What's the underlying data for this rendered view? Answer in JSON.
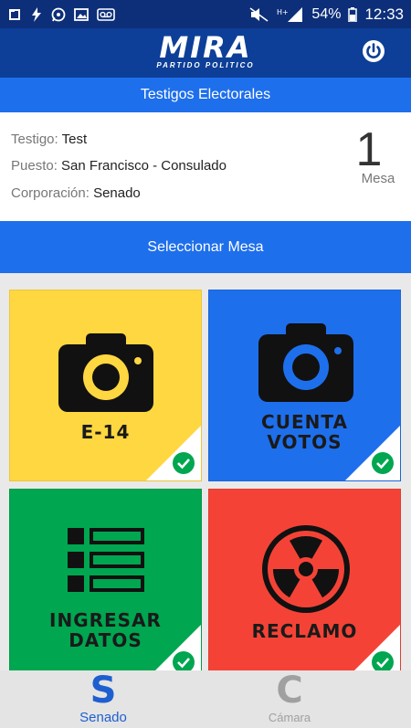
{
  "status_bar": {
    "icons_left": [
      "notification-icon",
      "flash-icon",
      "whatsapp-icon",
      "image-icon",
      "voicemail-icon"
    ],
    "battery": "54%",
    "time": "12:33"
  },
  "header": {
    "logo_title": "MIRA",
    "logo_subtitle": "PARTIDO POLITICO",
    "power_icon": "power-icon"
  },
  "section_title": "Testigos Electorales",
  "info": {
    "testigo_label": "Testigo:",
    "testigo_value": "Test",
    "puesto_label": "Puesto:",
    "puesto_value": "San Francisco - Consulado",
    "corporacion_label": "Corporación:",
    "corporacion_value": "Senado",
    "mesa_number": "1",
    "mesa_label": "Mesa"
  },
  "select_button": "Seleccionar Mesa",
  "tiles": [
    {
      "label_line1": "E-14",
      "label_line2": "",
      "color": "#ffd740",
      "icon": "camera-icon"
    },
    {
      "label_line1": "CUENTA",
      "label_line2": "VOTOS",
      "color": "#1e6fec",
      "icon": "camera-icon"
    },
    {
      "label_line1": "INGRESAR",
      "label_line2": "DATOS",
      "color": "#00a650",
      "icon": "list-icon"
    },
    {
      "label_line1": "RECLAMO",
      "label_line2": "",
      "color": "#f44336",
      "icon": "radiation-icon"
    }
  ],
  "bottom_nav": {
    "senado_letter": "S",
    "senado_label": "Senado",
    "camara_letter": "C",
    "camara_label": "Cámara"
  },
  "colors": {
    "header_bg": "#0d3f98",
    "accent_blue": "#1e6fec",
    "check_green": "#00a650",
    "active_nav": "#1e5fd0",
    "inactive_nav": "#9e9e9e"
  }
}
